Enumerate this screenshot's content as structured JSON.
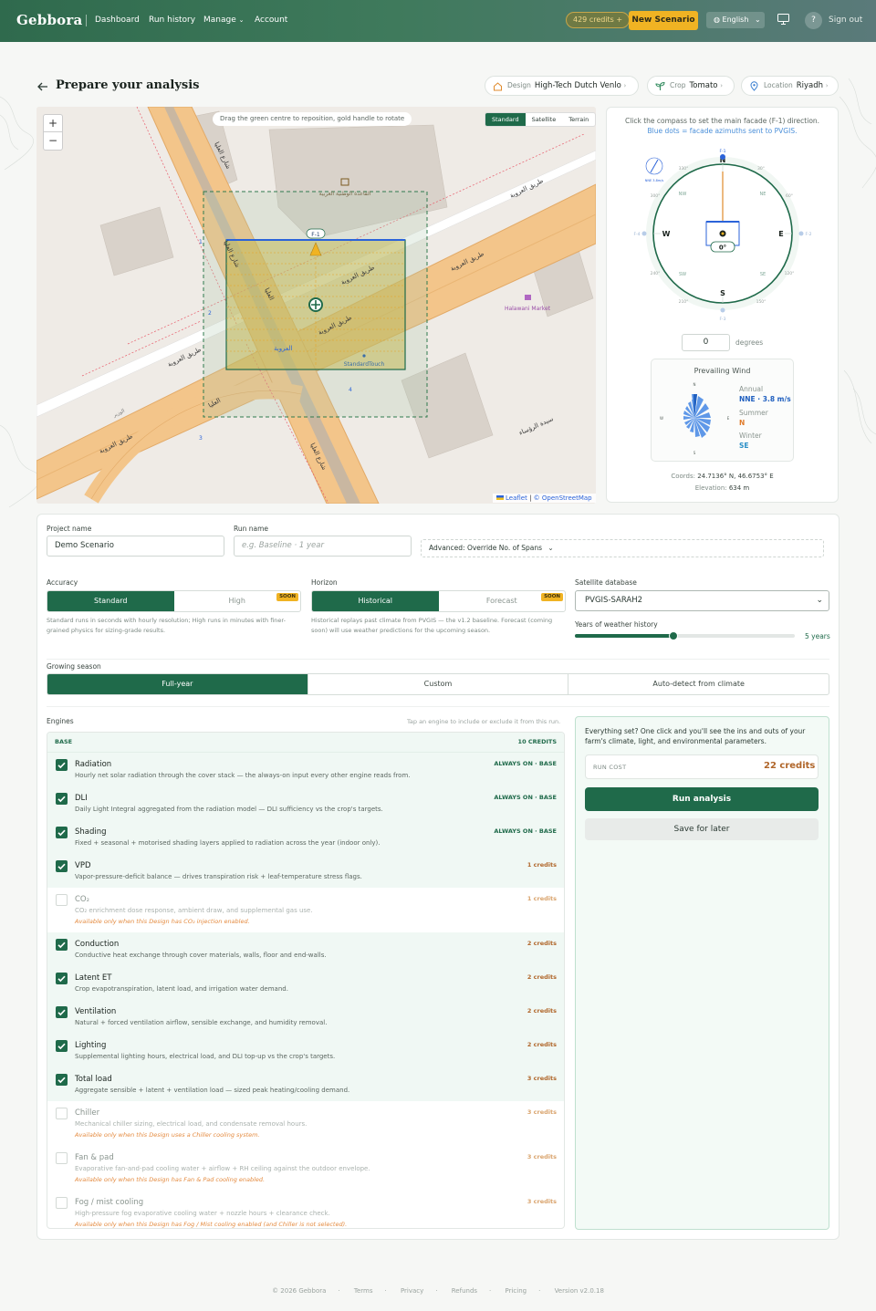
{
  "header": {
    "logo": "Gebbora",
    "nav": [
      "Dashboard",
      "Run history",
      "Manage",
      "Account"
    ],
    "credits": "429 credits",
    "new_scenario": "New Scenario",
    "language": "English",
    "sign_out": "Sign out",
    "help": "?"
  },
  "page": {
    "title": "Prepare your analysis",
    "pills": [
      {
        "label": "Design",
        "value": "High-Tech Dutch Venlo"
      },
      {
        "label": "Crop",
        "value": "Tomato"
      },
      {
        "label": "Location",
        "value": "Riyadh"
      }
    ]
  },
  "map": {
    "hint": "Drag the green centre to reposition, gold handle to rotate",
    "tabs": [
      "Standard",
      "Satellite",
      "Terrain"
    ],
    "active_tab": "Standard",
    "zoom_in": "+",
    "zoom_out": "−",
    "attribution_leaflet": "Leaflet",
    "attribution_osm": "© OpenStreetMap",
    "labels": {
      "road1": "طريق العروبة",
      "road2": "طريق العروبة",
      "road3": "طريق العروبة",
      "road4": "طريق العروبة",
      "road5": "طريق العروبة",
      "road6": "طريق العروبة",
      "street1": "شارع العليا",
      "street2": "شارع العليا",
      "street3": "شارع العليا",
      "street4": "العليا",
      "street5": "العليا",
      "street6": "سيدة الرؤساء",
      "place": "العروبة",
      "poi1": "Halawani Market",
      "poi2": "StandardTouch",
      "poi3": "القاعدة الوطنية العربية",
      "facade": "F-1",
      "bus1": "2",
      "bus2": "4",
      "bus3": "3",
      "bus4": "1",
      "poi4": "الوزير"
    }
  },
  "compass": {
    "hint1": "Click the compass to set the main facade (F-1) direction.",
    "hint2": "Blue dots = facade azimuths sent to PVGIS.",
    "cardinals": {
      "n": "N",
      "e": "E",
      "s": "S",
      "w": "W"
    },
    "intercardinals": [
      "NW",
      "NE",
      "SW",
      "SE"
    ],
    "degrees_ticks": [
      "330°",
      "30°",
      "300°",
      "60°",
      "240°",
      "120°",
      "210°",
      "150°"
    ],
    "facades": [
      "F-1",
      "F-2",
      "F-3",
      "F-4"
    ],
    "angle": "0°",
    "wind_mini": "NNE 3.8m/s",
    "degrees_value": "0",
    "degrees_label": "degrees"
  },
  "wind": {
    "title": "Prevailing Wind",
    "rose_labels": {
      "n": "N",
      "e": "E",
      "s": "S",
      "w": "W"
    },
    "annual_label": "Annual",
    "annual_value": "NNE · 3.8 m/s",
    "summer_label": "Summer",
    "summer_value": "N",
    "winter_label": "Winter",
    "winter_value": "SE",
    "colors": {
      "annual": "#1f5fbf",
      "summer": "#e07b2a",
      "winter": "#2a8fc7"
    }
  },
  "coords": {
    "label": "Coords:",
    "value": "24.7136° N, 46.6753° E",
    "elev_label": "Elevation:",
    "elev_value": "634 m"
  },
  "form": {
    "project_label": "Project name",
    "project_value": "Demo Scenario",
    "run_label": "Run name",
    "run_placeholder": "e.g. Baseline · 1 year",
    "advanced": "Advanced: Override No. of Spans",
    "accuracy_label": "Accuracy",
    "accuracy_options": [
      "Standard",
      "High"
    ],
    "accuracy_soon": "SOON",
    "accuracy_help": "Standard runs in seconds with hourly resolution; High runs in minutes with finer-grained physics for sizing-grade results.",
    "horizon_label": "Horizon",
    "horizon_options": [
      "Historical",
      "Forecast"
    ],
    "horizon_soon": "SOON",
    "horizon_help": "Historical replays past climate from PVGIS — the v1.2 baseline. Forecast (coming soon) will use weather predictions for the upcoming season.",
    "satdb_label": "Satellite database",
    "satdb_value": "PVGIS-SARAH2",
    "years_label": "Years of weather history",
    "years_value": "5 years",
    "years_fraction": 0.45,
    "season_label": "Growing season",
    "season_options": [
      "Full-year",
      "Custom",
      "Auto-detect from climate"
    ]
  },
  "engines": {
    "label": "Engines",
    "hint": "Tap an engine to include or exclude it from this run.",
    "base_label": "BASE",
    "base_credits": "10 CREDITS",
    "items": [
      {
        "name": "Radiation",
        "desc": "Hourly net solar radiation through the cover stack — the always-on input every other engine reads from.",
        "cost": "ALWAYS ON · BASE",
        "checked": true,
        "base": true
      },
      {
        "name": "DLI",
        "desc": "Daily Light Integral aggregated from the radiation model — DLI sufficiency vs the crop's targets.",
        "cost": "ALWAYS ON · BASE",
        "checked": true,
        "base": true
      },
      {
        "name": "Shading",
        "desc": "Fixed + seasonal + motorised shading layers applied to radiation across the year (indoor only).",
        "cost": "ALWAYS ON · BASE",
        "checked": true,
        "base": true
      },
      {
        "name": "VPD",
        "desc": "Vapor-pressure-deficit balance — drives transpiration risk + leaf-temperature stress flags.",
        "cost": "1 credits",
        "checked": true
      },
      {
        "name": "CO₂",
        "desc": "CO₂ enrichment dose response, ambient draw, and supplemental gas use.",
        "note": "Available only when this Design has CO₂ injection enabled.",
        "cost": "1 credits",
        "checked": false,
        "disabled": true
      },
      {
        "name": "Conduction",
        "desc": "Conductive heat exchange through cover materials, walls, floor and end-walls.",
        "cost": "2 credits",
        "checked": true
      },
      {
        "name": "Latent ET",
        "desc": "Crop evapotranspiration, latent load, and irrigation water demand.",
        "cost": "2 credits",
        "checked": true
      },
      {
        "name": "Ventilation",
        "desc": "Natural + forced ventilation airflow, sensible exchange, and humidity removal.",
        "cost": "2 credits",
        "checked": true
      },
      {
        "name": "Lighting",
        "desc": "Supplemental lighting hours, electrical load, and DLI top-up vs the crop's targets.",
        "cost": "2 credits",
        "checked": true
      },
      {
        "name": "Total load",
        "desc": "Aggregate sensible + latent + ventilation load — sized peak heating/cooling demand.",
        "cost": "3 credits",
        "checked": true
      },
      {
        "name": "Chiller",
        "desc": "Mechanical chiller sizing, electrical load, and condensate removal hours.",
        "note": "Available only when this Design uses a Chiller cooling system.",
        "cost": "3 credits",
        "checked": false,
        "disabled": true
      },
      {
        "name": "Fan & pad",
        "desc": "Evaporative fan-and-pad cooling water + airflow + RH ceiling against the outdoor envelope.",
        "note": "Available only when this Design has Fan & Pad cooling enabled.",
        "cost": "3 credits",
        "checked": false,
        "disabled": true
      },
      {
        "name": "Fog / mist cooling",
        "desc": "High-pressure fog evaporative cooling water + nozzle hours + clearance check.",
        "note": "Available only when this Design has Fog / Mist cooling enabled (and Chiller is not selected).",
        "cost": "3 credits",
        "checked": false,
        "disabled": true
      }
    ]
  },
  "run": {
    "text": "Everything set? One click and you'll see the ins and outs of your farm's climate, light, and environmental parameters.",
    "cost_label": "RUN COST",
    "cost_value": "22 credits",
    "run_button": "Run analysis",
    "save_button": "Save for later"
  },
  "footer": {
    "items": [
      "© 2026 Gebbora",
      "Terms",
      "Privacy",
      "Refunds",
      "Pricing",
      "Version v2.0.18"
    ]
  }
}
